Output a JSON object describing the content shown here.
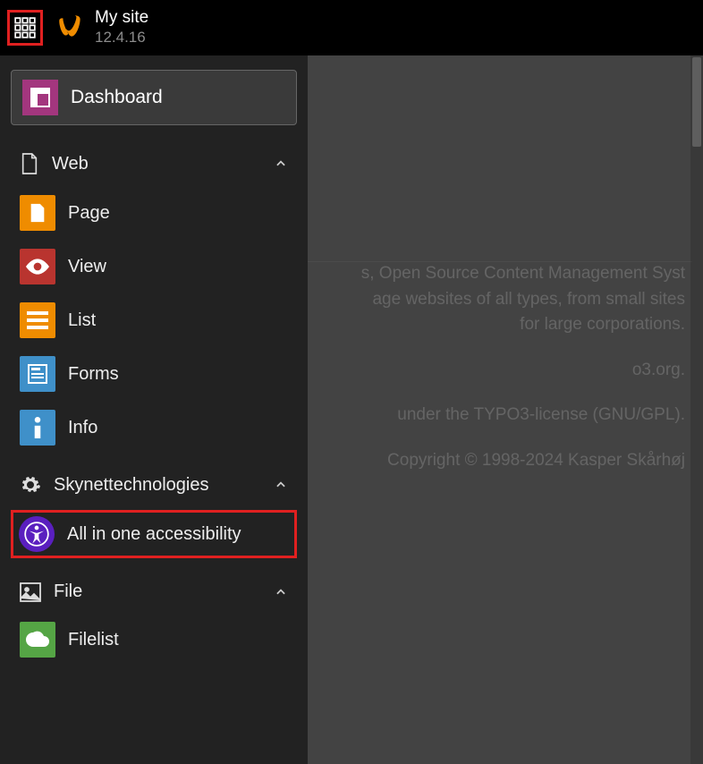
{
  "topbar": {
    "site_name": "My site",
    "version": "12.4.16"
  },
  "sidebar": {
    "dashboard_label": "Dashboard",
    "groups": [
      {
        "label": "Web",
        "expanded": true,
        "items": [
          {
            "label": "Page",
            "icon": "page-icon",
            "color": "ic-page"
          },
          {
            "label": "View",
            "icon": "view-icon",
            "color": "ic-view"
          },
          {
            "label": "List",
            "icon": "list-icon",
            "color": "ic-list"
          },
          {
            "label": "Forms",
            "icon": "forms-icon",
            "color": "ic-forms"
          },
          {
            "label": "Info",
            "icon": "info-icon",
            "color": "ic-info"
          }
        ]
      },
      {
        "label": "Skynettechnologies",
        "expanded": true,
        "icon": "gear-icon",
        "items": [
          {
            "label": "All in one accessibility",
            "icon": "accessibility-icon",
            "color": "ic-a11y",
            "highlight": true
          }
        ]
      },
      {
        "label": "File",
        "expanded": true,
        "icon": "image-icon",
        "items": [
          {
            "label": "Filelist",
            "icon": "filelist-icon",
            "color": "ic-filelist"
          }
        ]
      }
    ]
  },
  "content": {
    "p1": "s, Open Source Content Management Syst",
    "p2": "age websites of all types, from small sites",
    "p3": "for large corporations.",
    "p4": "o3.org.",
    "p5": "under the TYPO3-license (GNU/GPL).",
    "p6": "Copyright © 1998-2024 Kasper Skårhøj"
  }
}
